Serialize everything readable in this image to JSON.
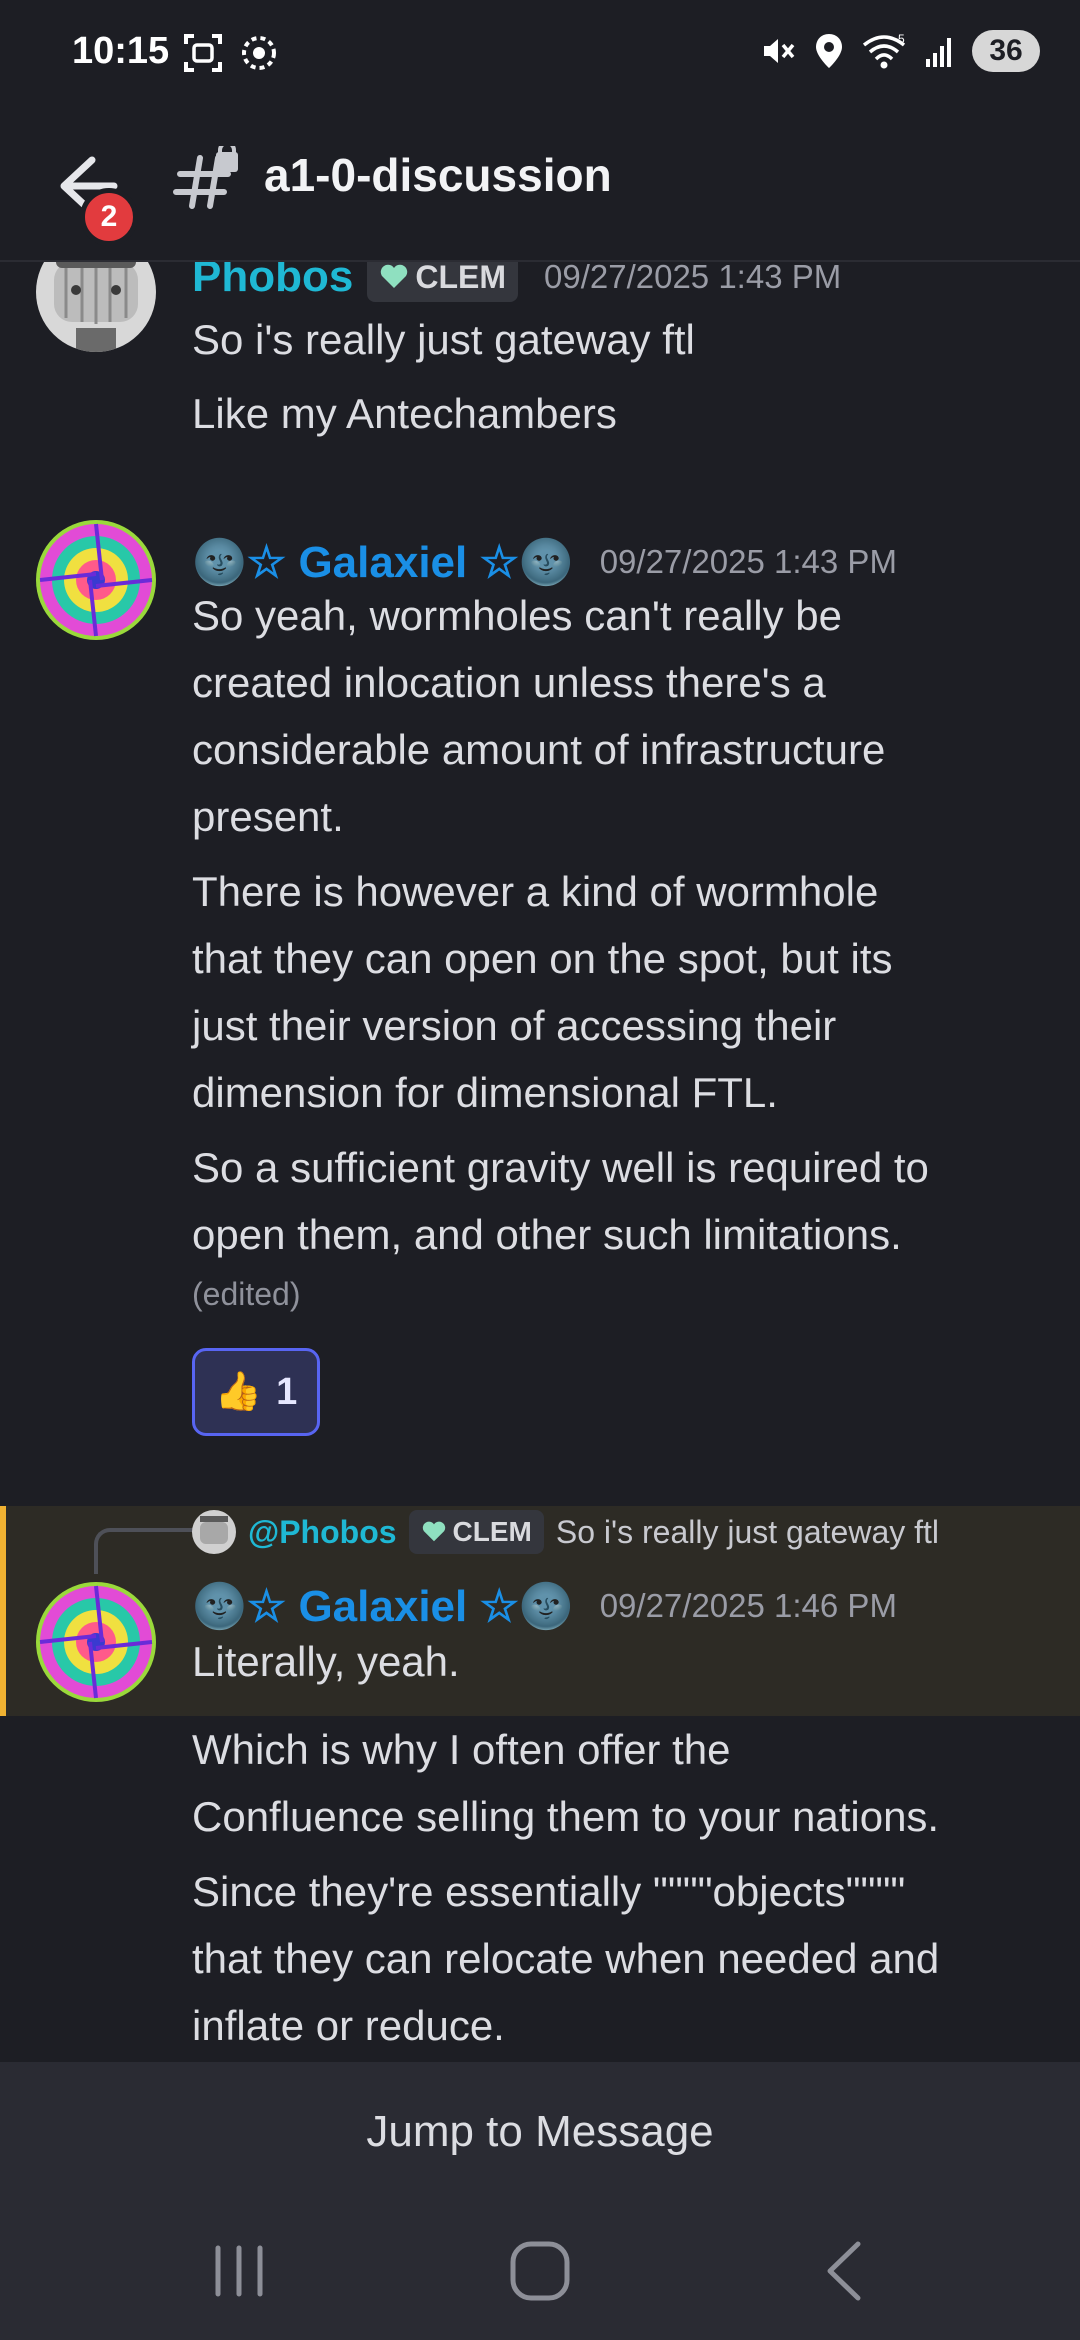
{
  "status_bar": {
    "time": "10:15",
    "signal_label": "5",
    "battery": "36",
    "icons": [
      "screenshot-icon",
      "settings-icon",
      "mute-icon",
      "location-icon",
      "wifi-icon",
      "signal-icon"
    ]
  },
  "header": {
    "badge_count": "2",
    "channel_name": "a1-0-discussion"
  },
  "messages": [
    {
      "author": "Phobos",
      "author_color": "#1fb8d4",
      "tag": "CLEM",
      "timestamp": "09/27/2025 1:43 PM",
      "lines": [
        "So i's really just gateway ftl",
        "Like my Antechambers"
      ]
    },
    {
      "author": "🌚☆ Galaxiel ☆🌚",
      "author_color": "#1a8fe6",
      "timestamp": "09/27/2025 1:43 PM",
      "paragraphs": [
        [
          "So yeah, wormholes can't really be",
          "created inlocation unless there's a",
          "considerable amount of infrastructure",
          "present."
        ],
        [
          "There is however a kind of wormhole",
          "that they can open on the spot, but its",
          "just their version of accessing their",
          "dimension for dimensional FTL."
        ],
        [
          "So a sufficient gravity well is required to",
          "open them, and other such limitations."
        ]
      ],
      "edited": "(edited)",
      "reaction": {
        "emoji": "👍",
        "count": "1"
      }
    },
    {
      "reply": {
        "author": "@Phobos",
        "tag": "CLEM",
        "text": "So i's really just gateway ftl"
      },
      "author": "🌚☆ Galaxiel ☆🌚",
      "author_color": "#1a8fe6",
      "timestamp": "09/27/2025 1:46 PM",
      "paragraphs": [
        [
          "Literally, yeah."
        ],
        [
          "Which is why I often offer the",
          "Confluence selling them to your nations."
        ],
        [
          "Since they're essentially \"\"\"\"objects\"\"\"\"",
          "that they can relocate when needed and",
          "inflate or reduce."
        ]
      ]
    }
  ],
  "jump_bar": {
    "label": "Jump to Message"
  },
  "nav": {
    "icons": [
      "recent-apps-icon",
      "home-icon",
      "back-nav-icon"
    ]
  }
}
